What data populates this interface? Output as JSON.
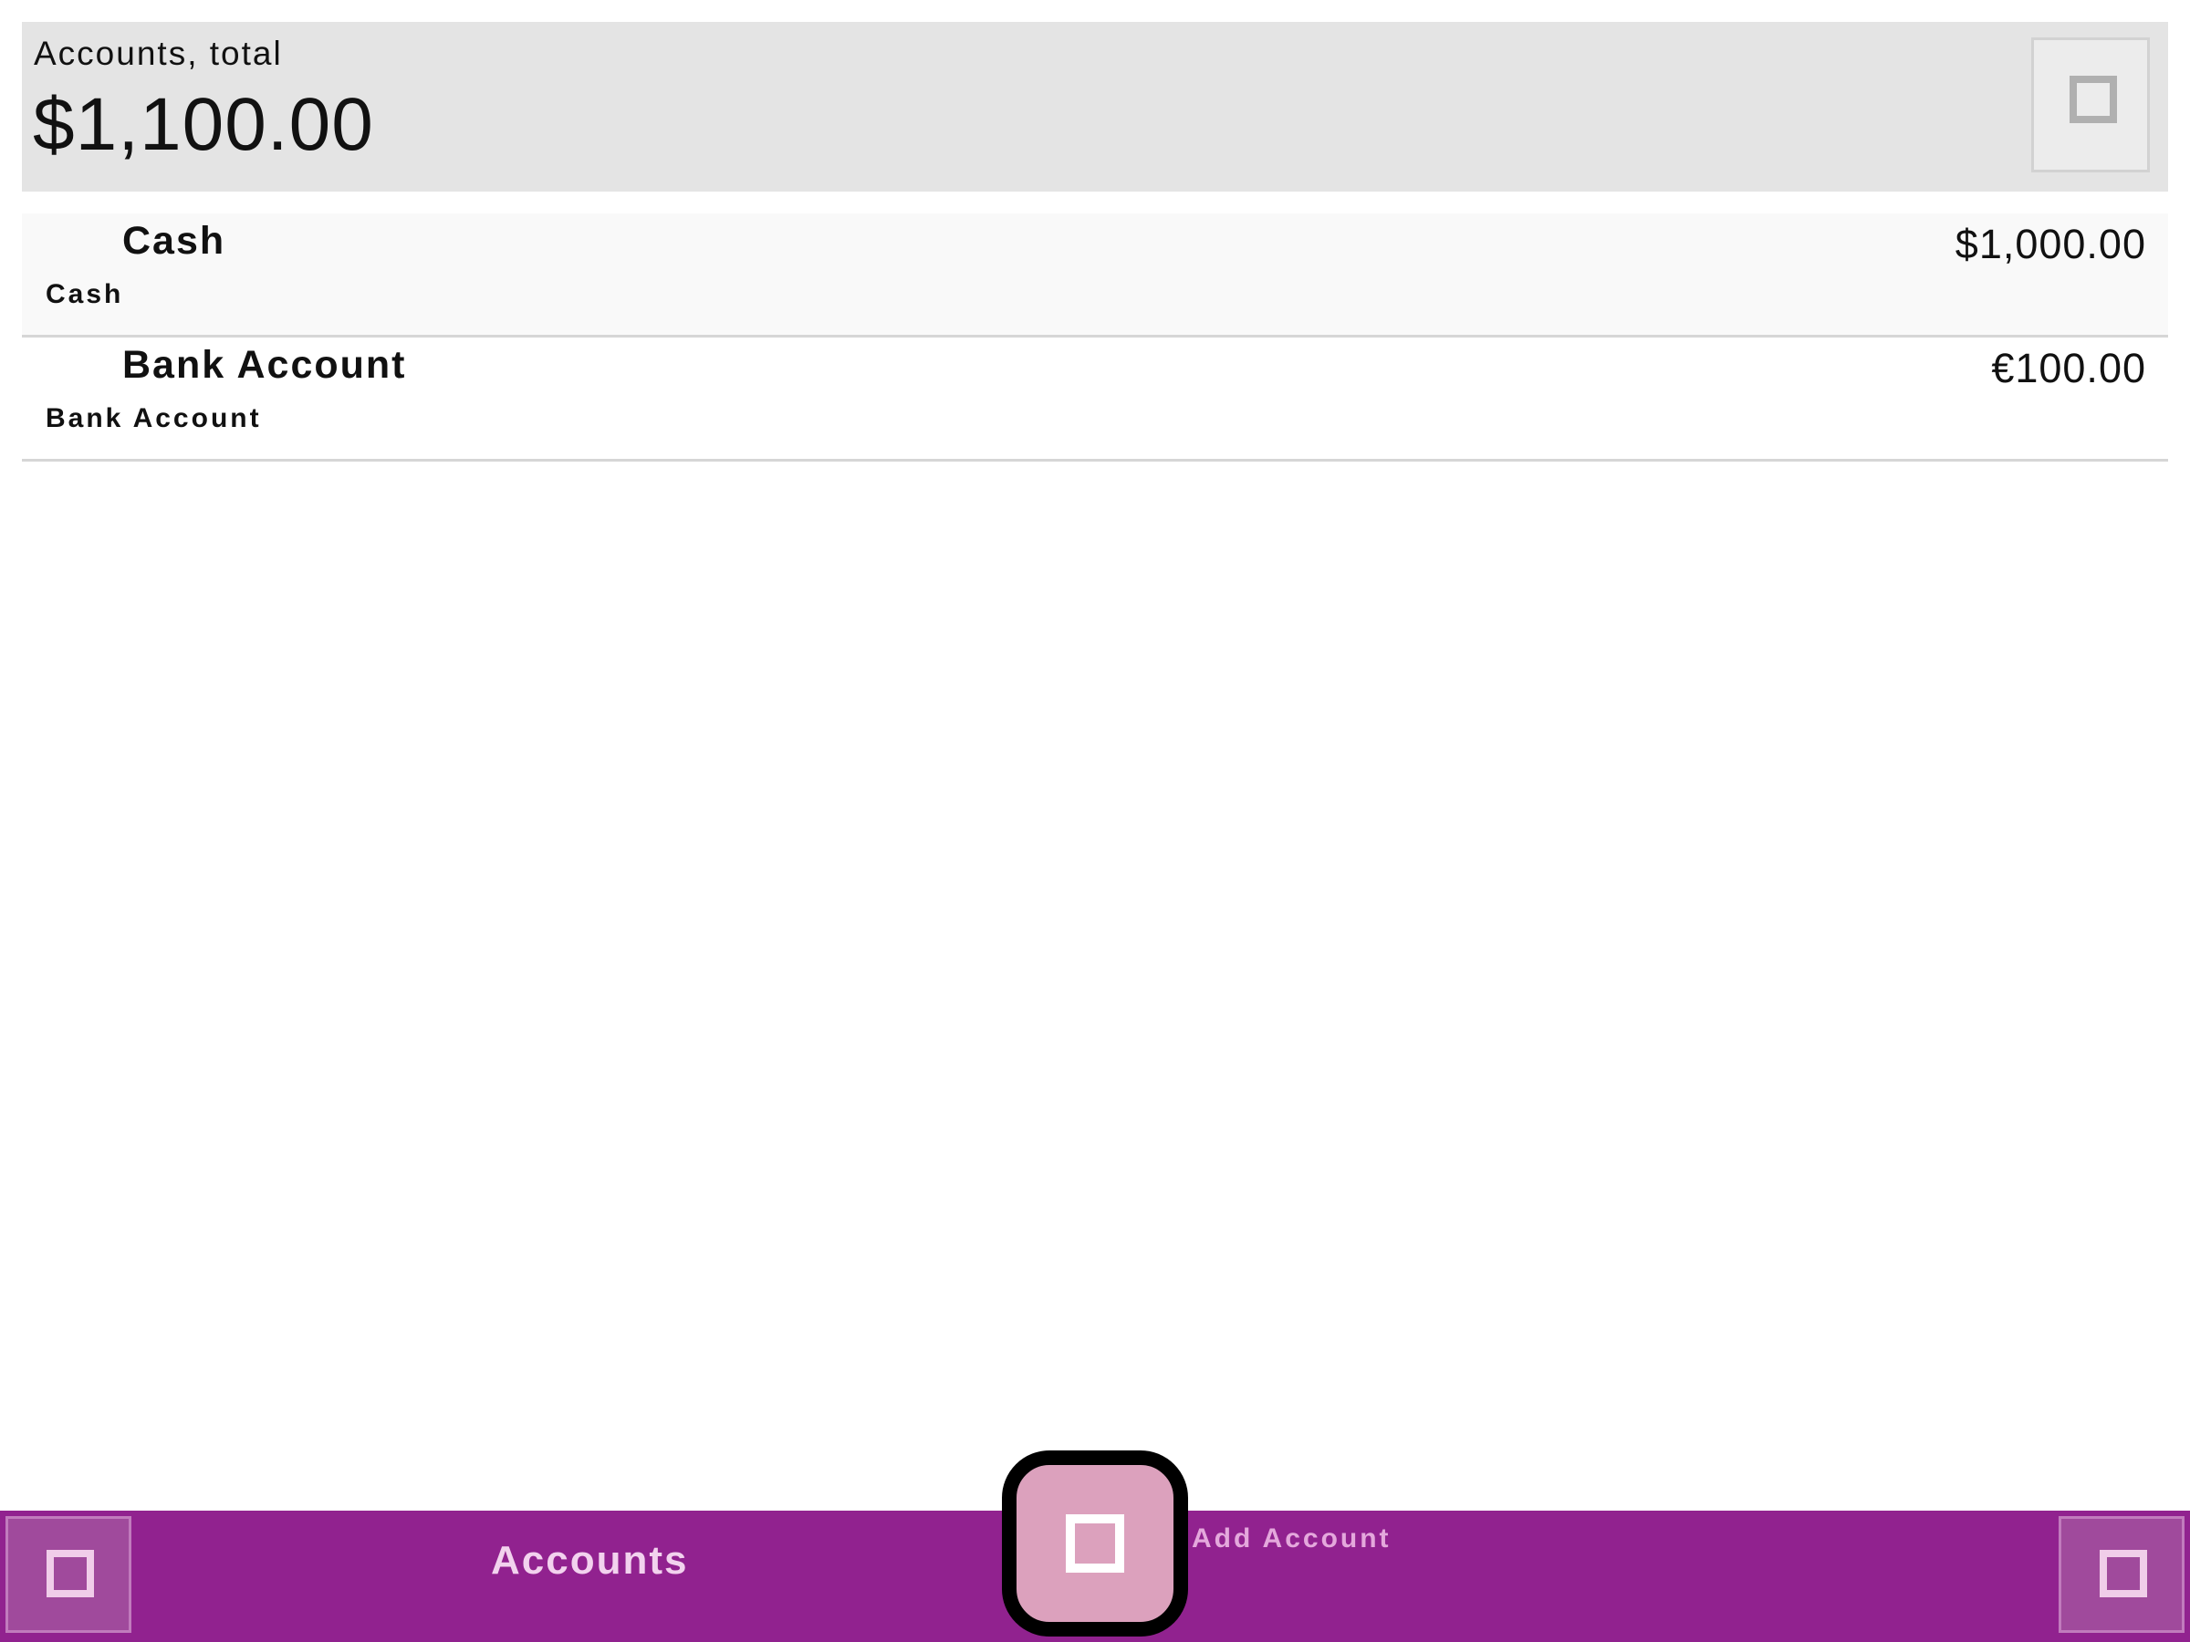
{
  "summary": {
    "label": "Accounts, total",
    "total": "$1,100.00",
    "action_icon": "square-icon"
  },
  "accounts": [
    {
      "name": "Cash",
      "type": "Cash",
      "balance": "$1,000.00"
    },
    {
      "name": "Bank Account",
      "type": "Bank Account",
      "balance": "€100.00"
    }
  ],
  "bottom_bar": {
    "title": "Accounts",
    "left_icon": "menu-icon",
    "right_icon": "options-icon",
    "add_icon": "add-icon",
    "add_label": "Add Account"
  },
  "colors": {
    "bar": "#91228f",
    "fab": "#dca1bd",
    "summary_bg": "#e4e4e4"
  }
}
